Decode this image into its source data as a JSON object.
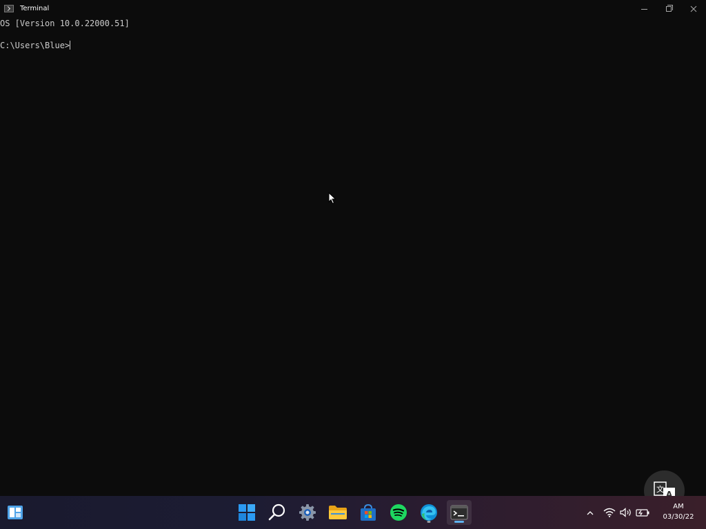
{
  "window": {
    "title": "Terminal",
    "controls": {
      "minimize_icon": "minimize-icon",
      "restore_icon": "restore-icon",
      "close_icon": "close-icon"
    }
  },
  "terminal": {
    "lines": [
      "OS [Version 10.0.22000.51]",
      "C:\\Users\\Blue>"
    ],
    "background": "#0c0c0c",
    "foreground": "#cccccc"
  },
  "taskbar": {
    "left_widget_icon": "widgets-icon",
    "apps": [
      {
        "name": "Start",
        "icon": "windows-start-icon"
      },
      {
        "name": "Search",
        "icon": "search-icon"
      },
      {
        "name": "Settings",
        "icon": "gear-icon"
      },
      {
        "name": "File Explorer",
        "icon": "folder-icon"
      },
      {
        "name": "Microsoft Store",
        "icon": "store-icon"
      },
      {
        "name": "Spotify",
        "icon": "spotify-icon"
      },
      {
        "name": "Microsoft Edge",
        "icon": "edge-icon"
      },
      {
        "name": "Terminal",
        "icon": "terminal-icon"
      }
    ],
    "tray": {
      "overflow_icon": "chevron-up-icon",
      "wifi_icon": "wifi-icon",
      "volume_icon": "volume-icon",
      "battery_icon": "battery-icon"
    },
    "clock": {
      "time": "AM",
      "date": "03/30/22"
    }
  },
  "overlay": {
    "translate_button_icon": "translate-icon"
  },
  "colors": {
    "accent": "#5fb2f0",
    "windows_blue": "#2b9af3",
    "spotify_green": "#1ed760"
  }
}
